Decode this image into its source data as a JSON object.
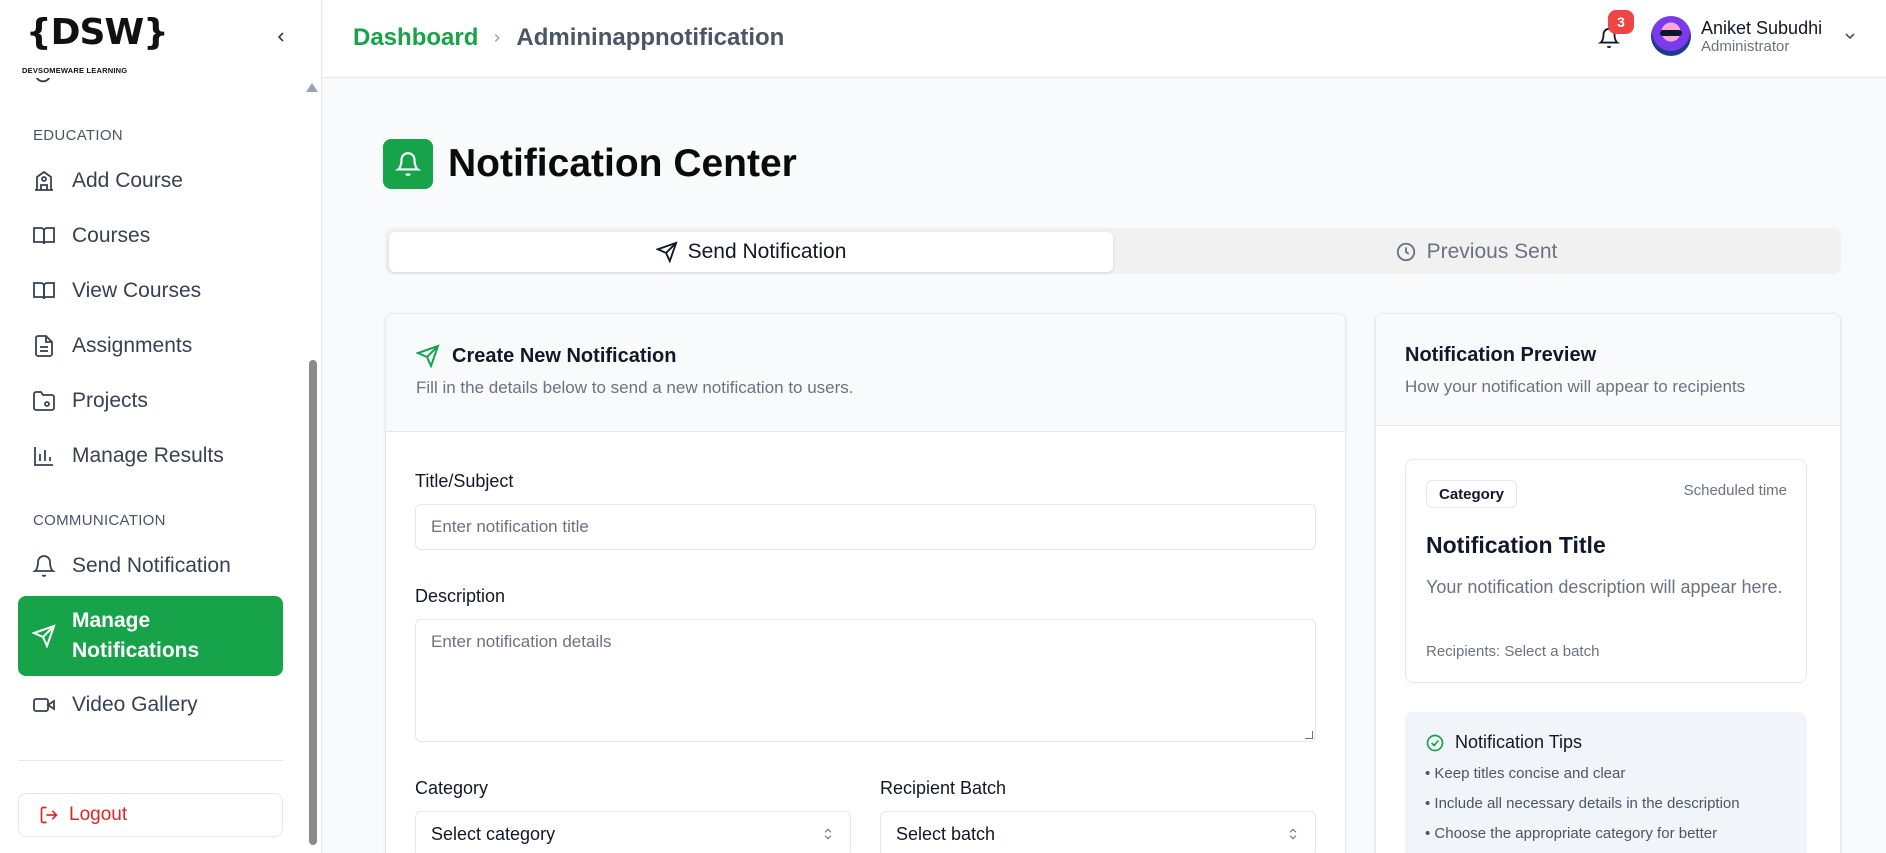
{
  "brand": {
    "logo_text": "{DSW}",
    "logo_subtitle": "DEVSOMEWARE LEARNING"
  },
  "sidebar": {
    "sections": [
      {
        "label": "EDUCATION"
      },
      {
        "label": "COMMUNICATION"
      }
    ],
    "items": [
      {
        "label": "Add Course",
        "icon": "building-icon"
      },
      {
        "label": "Courses",
        "icon": "book-open-icon"
      },
      {
        "label": "View Courses",
        "icon": "book-open-icon"
      },
      {
        "label": "Assignments",
        "icon": "file-text-icon"
      },
      {
        "label": "Projects",
        "icon": "folder-icon"
      },
      {
        "label": "Manage Results",
        "icon": "bar-chart-icon"
      },
      {
        "label": "Send Notification",
        "icon": "bell-icon"
      },
      {
        "label": "Manage Notifications",
        "icon": "send-icon",
        "active": true
      },
      {
        "label": "Video Gallery",
        "icon": "video-icon"
      }
    ],
    "logout_label": "Logout"
  },
  "header": {
    "breadcrumb_home": "Dashboard",
    "breadcrumb_current": "Admininappnotification",
    "notification_count": "3",
    "user_name": "Aniket Subudhi",
    "user_role": "Administrator"
  },
  "page": {
    "title": "Notification Center",
    "tabs": [
      {
        "label": "Send Notification",
        "active": true
      },
      {
        "label": "Previous Sent",
        "active": false
      }
    ]
  },
  "form": {
    "title": "Create New Notification",
    "subtitle": "Fill in the details below to send a new notification to users.",
    "title_label": "Title/Subject",
    "title_placeholder": "Enter notification title",
    "description_label": "Description",
    "description_placeholder": "Enter notification details",
    "category_label": "Category",
    "category_value": "Select category",
    "batch_label": "Recipient Batch",
    "batch_value": "Select batch"
  },
  "preview": {
    "title": "Notification Preview",
    "subtitle": "How your notification will appear to recipients",
    "category_pill": "Category",
    "scheduled": "Scheduled time",
    "notification_title": "Notification Title",
    "notification_description": "Your notification description will appear here.",
    "recipients": "Recipients: Select a batch"
  },
  "tips": {
    "title": "Notification Tips",
    "items": [
      "• Keep titles concise and clear",
      "• Include all necessary details in the description",
      "• Choose the appropriate category for better"
    ]
  },
  "colors": {
    "accent": "#16a34a",
    "danger": "#dc2626",
    "badge": "#ef4444"
  }
}
